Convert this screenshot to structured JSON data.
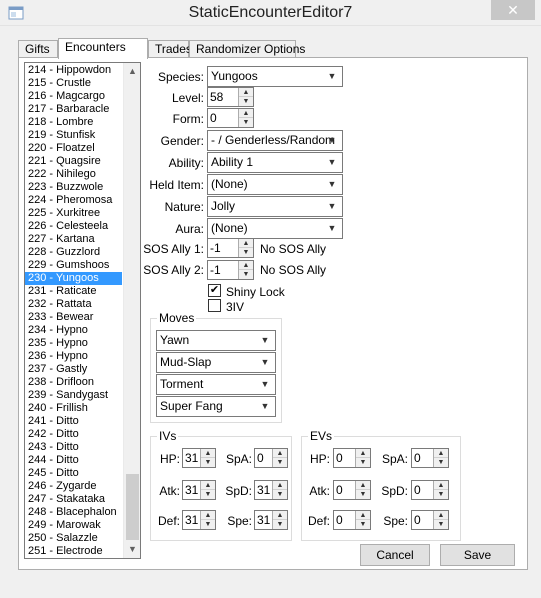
{
  "window": {
    "title": "StaticEncounterEditor7",
    "close_glyph": "✕"
  },
  "tabs": [
    {
      "label": "Gifts"
    },
    {
      "label": "Encounters"
    },
    {
      "label": "Trades"
    },
    {
      "label": "Randomizer Options"
    }
  ],
  "encounter_list": {
    "items": [
      "214 - Hippowdon",
      "215 - Crustle",
      "216 - Magcargo",
      "217 - Barbaracle",
      "218 - Lombre",
      "219 - Stunfisk",
      "220 - Floatzel",
      "221 - Quagsire",
      "222 - Nihilego",
      "223 - Buzzwole",
      "224 - Pheromosa",
      "225 - Xurkitree",
      "226 - Celesteela",
      "227 - Kartana",
      "228 - Guzzlord",
      "229 - Gumshoos",
      "230 - Yungoos",
      "231 - Raticate",
      "232 - Rattata",
      "233 - Bewear",
      "234 - Hypno",
      "235 - Hypno",
      "236 - Hypno",
      "237 - Gastly",
      "238 - Drifloon",
      "239 - Sandygast",
      "240 - Frillish",
      "241 - Ditto",
      "242 - Ditto",
      "243 - Ditto",
      "244 - Ditto",
      "245 - Ditto",
      "246 - Zygarde",
      "247 - Stakataka",
      "248 - Blacephalon",
      "249 - Marowak",
      "250 - Salazzle",
      "251 - Electrode"
    ],
    "selected": "230 - Yungoos"
  },
  "form": {
    "species": {
      "label": "Species:",
      "value": "Yungoos"
    },
    "level": {
      "label": "Level:",
      "value": "58"
    },
    "form": {
      "label": "Form:",
      "value": "0"
    },
    "gender": {
      "label": "Gender:",
      "value": "- / Genderless/Random"
    },
    "ability": {
      "label": "Ability:",
      "value": "Ability 1"
    },
    "held_item": {
      "label": "Held Item:",
      "value": "(None)"
    },
    "nature": {
      "label": "Nature:",
      "value": "Jolly"
    },
    "aura": {
      "label": "Aura:",
      "value": "(None)"
    },
    "sos_ally_1": {
      "label": "SOS Ally 1:",
      "value": "-1",
      "desc": "No SOS Ally"
    },
    "sos_ally_2": {
      "label": "SOS Ally 2:",
      "value": "-1",
      "desc": "No SOS Ally"
    },
    "shiny_lock": {
      "label": "Shiny Lock",
      "checked": true
    },
    "three_iv": {
      "label": "3IV",
      "checked": false
    }
  },
  "moves": {
    "title": "Moves",
    "items": [
      "Yawn",
      "Mud-Slap",
      "Torment",
      "Super Fang"
    ]
  },
  "ivs": {
    "title": "IVs",
    "hp": {
      "label": "HP:",
      "value": "31"
    },
    "atk": {
      "label": "Atk:",
      "value": "31"
    },
    "def": {
      "label": "Def:",
      "value": "31"
    },
    "spa": {
      "label": "SpA:",
      "value": "0"
    },
    "spd": {
      "label": "SpD:",
      "value": "31"
    },
    "spe": {
      "label": "Spe:",
      "value": "31"
    }
  },
  "evs": {
    "title": "EVs",
    "hp": {
      "label": "HP:",
      "value": "0"
    },
    "atk": {
      "label": "Atk:",
      "value": "0"
    },
    "def": {
      "label": "Def:",
      "value": "0"
    },
    "spa": {
      "label": "SpA:",
      "value": "0"
    },
    "spd": {
      "label": "SpD:",
      "value": "0"
    },
    "spe": {
      "label": "Spe:",
      "value": "0"
    }
  },
  "buttons": {
    "cancel": "Cancel",
    "save": "Save"
  },
  "icons": {
    "dropdown": "▼",
    "spin_up": "▲",
    "spin_down": "▼",
    "check": "✔"
  }
}
